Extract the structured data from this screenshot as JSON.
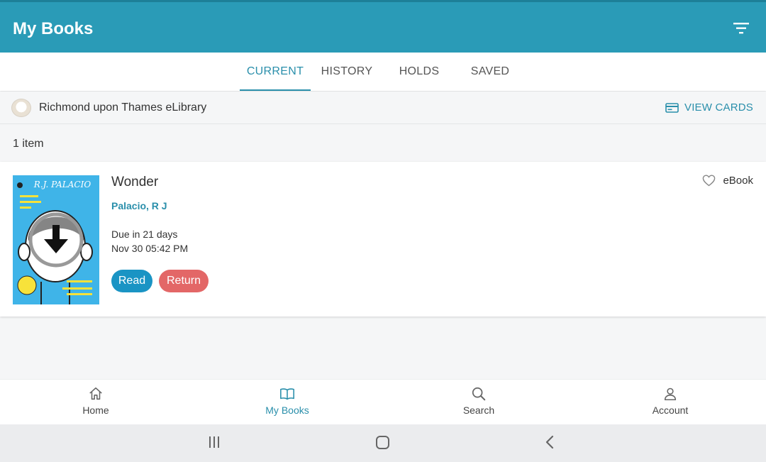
{
  "app_bar": {
    "title": "My Books",
    "filter_icon": "filter-icon"
  },
  "tabs": [
    {
      "label": "CURRENT",
      "active": true
    },
    {
      "label": "HISTORY",
      "active": false
    },
    {
      "label": "HOLDS",
      "active": false
    },
    {
      "label": "SAVED",
      "active": false
    }
  ],
  "library": {
    "name": "Richmond upon Thames eLibrary",
    "view_cards_label": "VIEW CARDS",
    "card_icon": "card-icon"
  },
  "count_text": "1 item",
  "book": {
    "title": "Wonder",
    "author": "Palacio, R J",
    "due_line": "Due in 21 days",
    "due_date": "Nov 30 05:42 PM",
    "format": "eBook",
    "read_label": "Read",
    "return_label": "Return",
    "cover_author": "R.J. PALACIO",
    "cover_icon": "download-icon"
  },
  "bottom_nav": [
    {
      "label": "Home",
      "icon": "home-icon",
      "active": false
    },
    {
      "label": "My Books",
      "icon": "book-icon",
      "active": true
    },
    {
      "label": "Search",
      "icon": "search-icon",
      "active": false
    },
    {
      "label": "Account",
      "icon": "account-icon",
      "active": false
    }
  ],
  "colors": {
    "primary": "#2a9bb7",
    "accent": "#2a8fab",
    "read": "#1a94c4",
    "return": "#e36767"
  }
}
